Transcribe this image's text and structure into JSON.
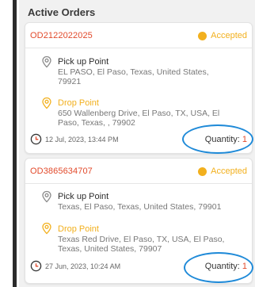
{
  "section_title": "Active Orders",
  "colors": {
    "order_id": "#e24a2b",
    "status": "#f2b01e",
    "drop_label": "#f2b01e",
    "highlight_oval": "#1f8ad8"
  },
  "orders": [
    {
      "order_id": "OD2122022025",
      "status": "Accepted",
      "pickup_label": "Pick up Point",
      "pickup_line1": "EL PASO, El Paso, Texas, United States,",
      "pickup_line2": "79921",
      "drop_label": "Drop Point",
      "drop_line1": "650 Wallenberg Drive, El Paso, TX, USA, El",
      "drop_line2": "Paso, Texas, , 79902",
      "datetime": "12 Jul, 2023, 13:44 PM",
      "quantity_label": "Quantity:",
      "quantity_value": "1"
    },
    {
      "order_id": "OD3865634707",
      "status": "Accepted",
      "pickup_label": "Pick up Point",
      "pickup_line1": "Texas, El Paso, Texas, United States, 79901",
      "drop_label": "Drop Point",
      "drop_line1": "Texas Red Drive, El Paso, TX, USA, El Paso,",
      "drop_line2": "Texas, United States, 79907",
      "datetime": "27 Jun, 2023, 10:24 AM",
      "quantity_label": "Quantity:",
      "quantity_value": "1"
    }
  ]
}
